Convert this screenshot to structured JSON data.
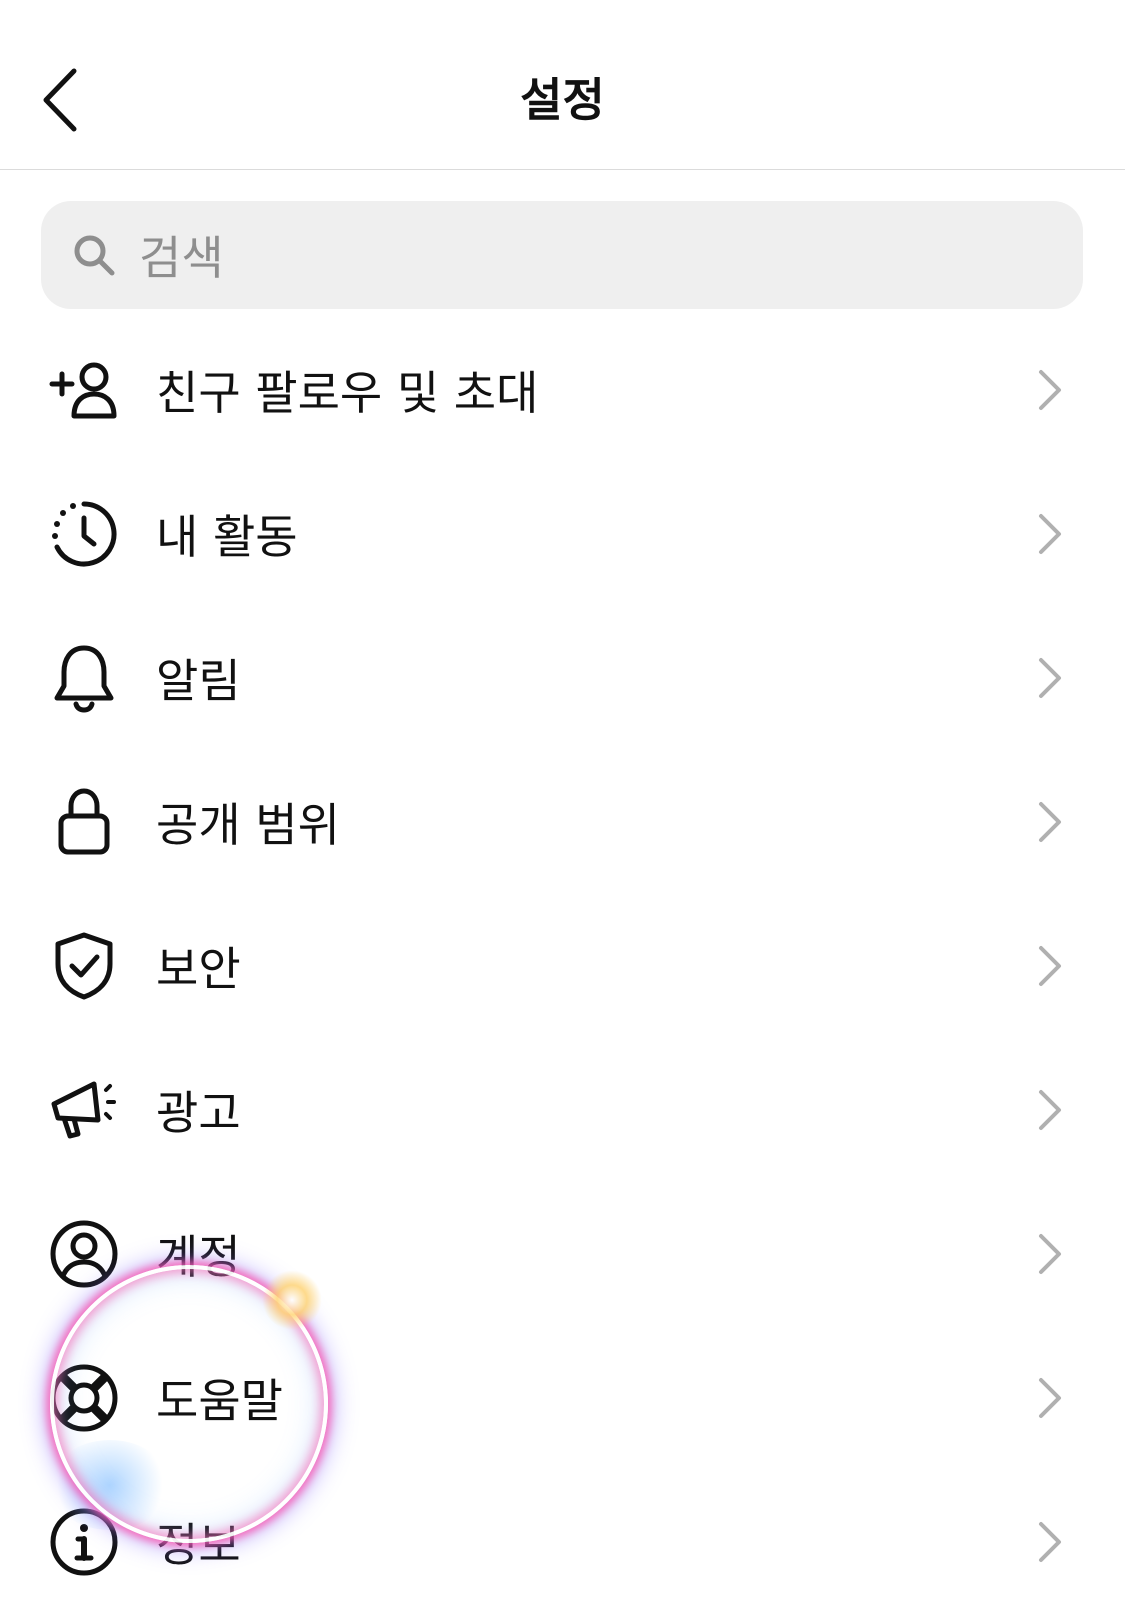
{
  "header": {
    "title": "설정",
    "back_icon": "chevron-left-icon"
  },
  "search": {
    "placeholder": "검색",
    "icon": "search-icon"
  },
  "menu": {
    "items": [
      {
        "label": "친구 팔로우 및 초대",
        "icon": "add-person-icon"
      },
      {
        "label": "내 활동",
        "icon": "activity-clock-icon"
      },
      {
        "label": "알림",
        "icon": "bell-icon"
      },
      {
        "label": "공개 범위",
        "icon": "lock-icon"
      },
      {
        "label": "보안",
        "icon": "shield-check-icon"
      },
      {
        "label": "광고",
        "icon": "megaphone-icon"
      },
      {
        "label": "계정",
        "icon": "account-circle-icon"
      },
      {
        "label": "도움말",
        "icon": "lifebuoy-icon"
      },
      {
        "label": "정보",
        "icon": "info-icon"
      }
    ]
  },
  "colors": {
    "background": "#ffffff",
    "search_bg": "#efefef",
    "placeholder": "#8e8e8e",
    "chevron": "#b0b0b0",
    "text": "#111111"
  }
}
